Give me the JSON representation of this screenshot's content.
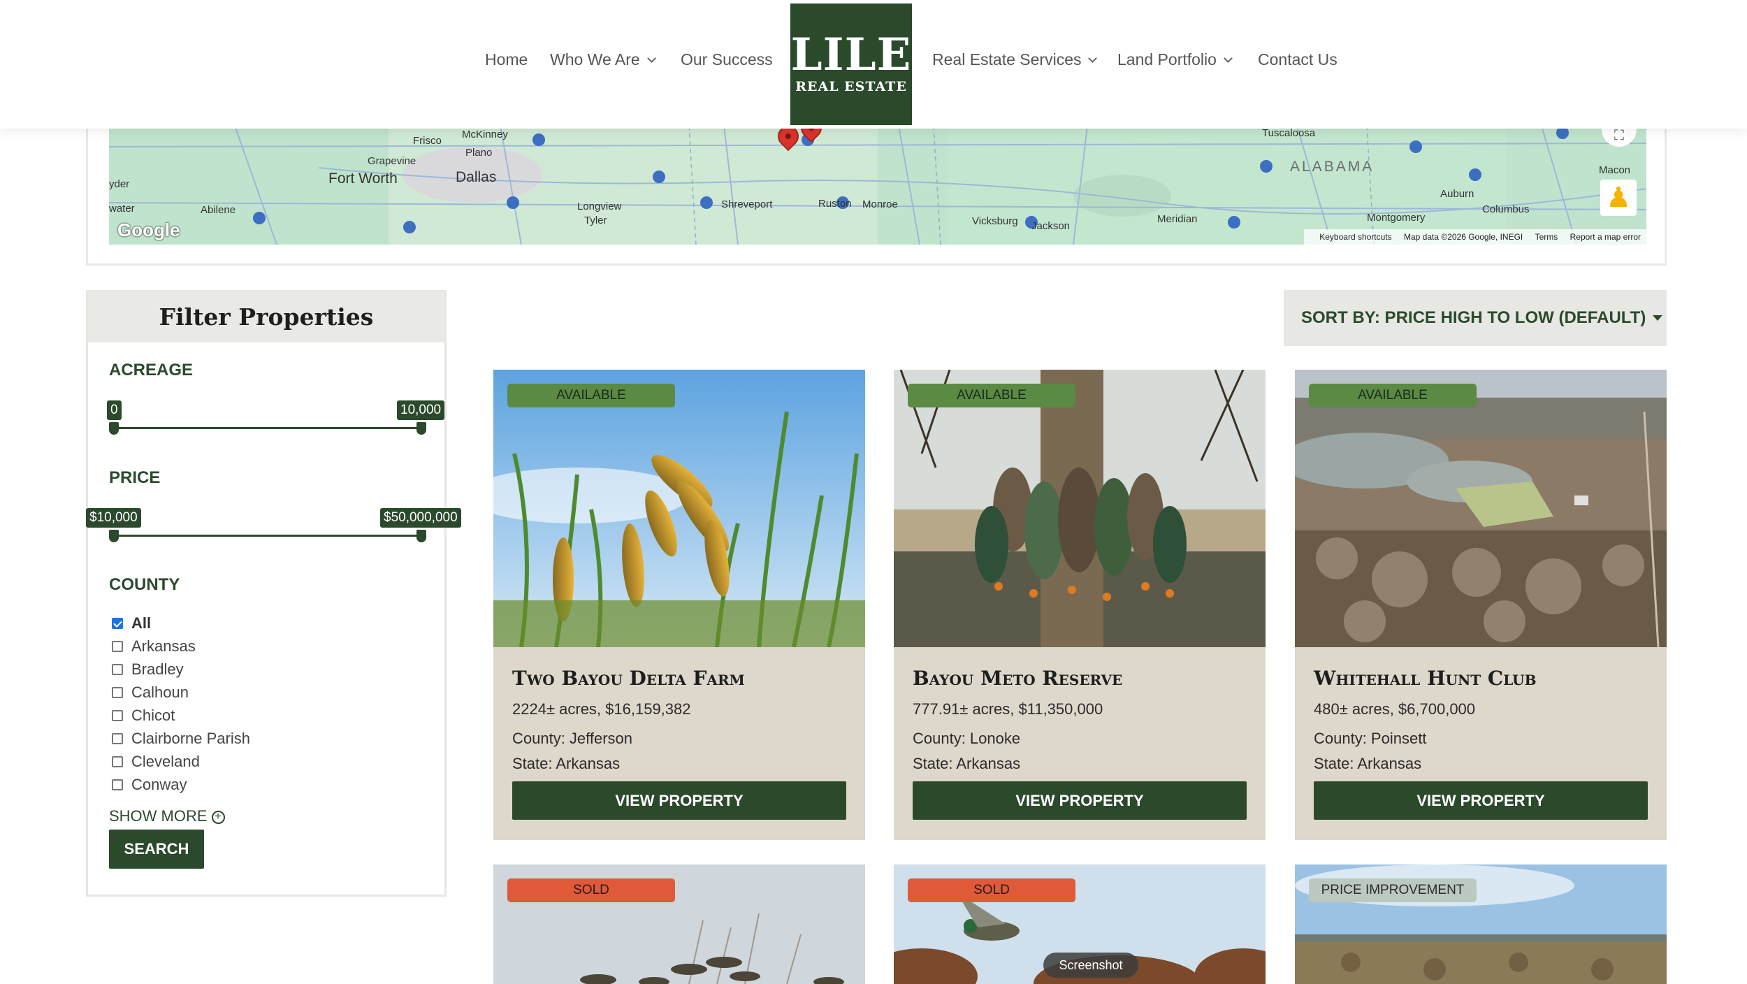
{
  "nav": {
    "home": "Home",
    "who_we_are": "Who We Are",
    "our_success": "Our Success",
    "real_estate_services": "Real Estate Services",
    "land_portfolio": "Land Portfolio",
    "contact_us": "Contact Us"
  },
  "logo": {
    "line1": "LILE",
    "line2": "REAL ESTATE"
  },
  "map": {
    "cities": {
      "frisco": "Frisco",
      "mckinney": "McKinney",
      "plano": "Plano",
      "grapevine": "Grapevine",
      "fort_worth": "Fort Worth",
      "dallas": "Dallas",
      "snyder": "yder",
      "sweetwater": "water",
      "abilene": "Abilene",
      "longview": "Longview",
      "tyler": "Tyler",
      "shreveport": "Shreveport",
      "ruston": "Ruston",
      "monroe": "Monroe",
      "vicksburg": "Vicksburg",
      "jackson": "Jackson",
      "meridian": "Meridian",
      "tuscaloosa": "Tuscaloosa",
      "auburn": "Auburn",
      "columbus": "Columbus",
      "montgomery": "Montgomery",
      "macon": "Macon"
    },
    "state": "ALABAMA",
    "google": "Google",
    "footer": {
      "shortcuts": "Keyboard shortcuts",
      "data": "Map data ©2026 Google, INEGI",
      "terms": "Terms",
      "report": "Report a map error"
    }
  },
  "filter": {
    "title": "Filter Properties",
    "acreage_label": "ACREAGE",
    "acreage_min": "0",
    "acreage_max": "10,000",
    "price_label": "PRICE",
    "price_min": "$10,000",
    "price_max": "$50,000,000",
    "county_label": "COUNTY",
    "counties": [
      {
        "name": "All",
        "checked": true
      },
      {
        "name": "Arkansas",
        "checked": false
      },
      {
        "name": "Bradley",
        "checked": false
      },
      {
        "name": "Calhoun",
        "checked": false
      },
      {
        "name": "Chicot",
        "checked": false
      },
      {
        "name": "Clairborne Parish",
        "checked": false
      },
      {
        "name": "Cleveland",
        "checked": false
      },
      {
        "name": "Conway",
        "checked": false
      }
    ],
    "show_more": "SHOW MORE",
    "search_button": "SEARCH"
  },
  "sort": {
    "label": "SORT BY: PRICE HIGH TO LOW (DEFAULT)"
  },
  "properties": [
    {
      "status": "AVAILABLE",
      "title": "Two Bayou Delta Farm",
      "acres_price": "2224± acres, $16,159,382",
      "county": "County: Jefferson",
      "state": "State: Arkansas",
      "button": "VIEW PROPERTY"
    },
    {
      "status": "AVAILABLE",
      "title": "Bayou Meto Reserve",
      "acres_price": "777.91± acres, $11,350,000",
      "county": "County: Lonoke",
      "state": "State: Arkansas",
      "button": "VIEW PROPERTY"
    },
    {
      "status": "AVAILABLE",
      "title": "Whitehall Hunt Club",
      "acres_price": "480± acres, $6,700,000",
      "county": "County: Poinsett",
      "state": "State: Arkansas",
      "button": "VIEW PROPERTY"
    },
    {
      "status": "SOLD"
    },
    {
      "status": "SOLD"
    },
    {
      "status": "PRICE IMPROVEMENT"
    }
  ],
  "overlay": {
    "screenshot": "Screenshot"
  }
}
